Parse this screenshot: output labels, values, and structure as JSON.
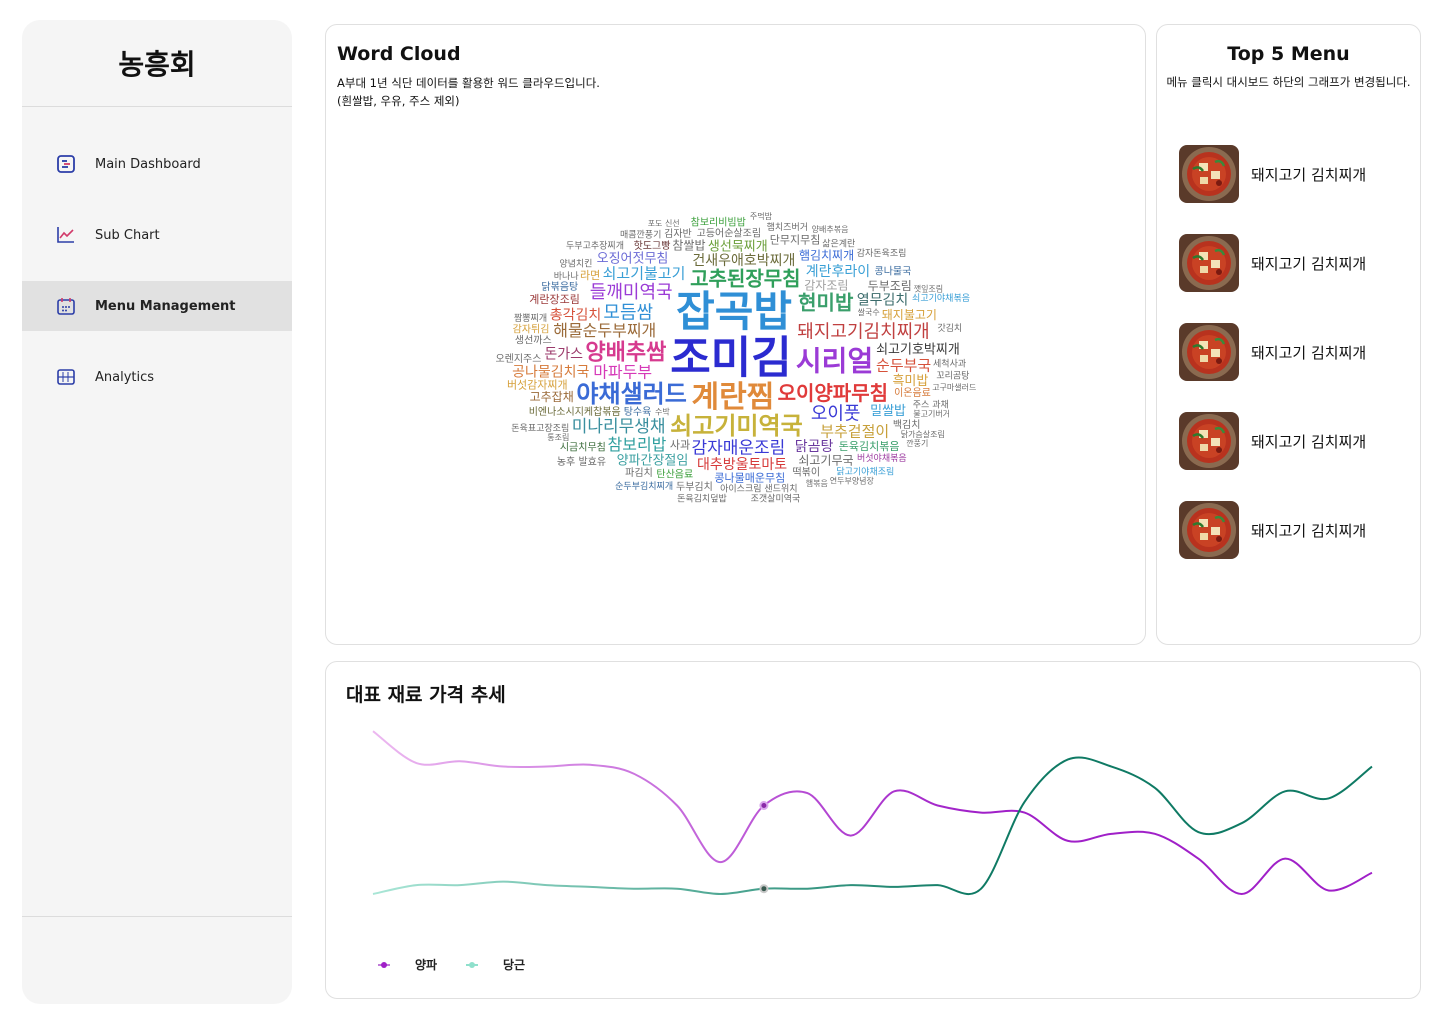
{
  "sidebar": {
    "brand": "농흥회",
    "items": [
      {
        "label": "Main Dashboard",
        "icon": "dashboard-icon",
        "active": false
      },
      {
        "label": "Sub Chart",
        "icon": "line-chart-icon",
        "active": false
      },
      {
        "label": "Menu Management",
        "icon": "calendar-icon",
        "active": true
      },
      {
        "label": "Analytics",
        "icon": "analytics-icon",
        "active": false
      }
    ]
  },
  "word_cloud": {
    "title": "Word Cloud",
    "description_line1": "A부대 1년 식단 데이터를 활용한 워드 클라우드입니다.",
    "description_line2": "(흰쌀밥, 우유, 주스 제외)",
    "words": [
      {
        "text": "조미김",
        "color": "#2b2bd0",
        "size": 44
      },
      {
        "text": "잡곡밥",
        "color": "#2f8fd6",
        "size": 42
      },
      {
        "text": "계란찜",
        "color": "#e08a3a",
        "size": 30
      },
      {
        "text": "시리얼",
        "color": "#9b3bd6",
        "size": 28
      },
      {
        "text": "쇠고기미역국",
        "color": "#c7b23a",
        "size": 24
      },
      {
        "text": "야채샐러드",
        "color": "#3a6bd6",
        "size": 24
      },
      {
        "text": "오이양파무침",
        "color": "#e03a3a",
        "size": 20
      },
      {
        "text": "양배추쌈",
        "color": "#d63a8f",
        "size": 22
      },
      {
        "text": "고추된장무침",
        "color": "#2f9f5a",
        "size": 20
      },
      {
        "text": "돼지고기김치찌개",
        "color": "#c04040",
        "size": 18
      },
      {
        "text": "해물순두부찌개",
        "color": "#9b6b3a",
        "size": 16
      },
      {
        "text": "모듬쌈",
        "color": "#2f8fd6",
        "size": 18
      },
      {
        "text": "현미밥",
        "color": "#3a9f6b",
        "size": 20
      },
      {
        "text": "들깨미역국",
        "color": "#9b3bd6",
        "size": 18
      },
      {
        "text": "감자매운조림",
        "color": "#3a3ad6",
        "size": 17
      },
      {
        "text": "오이풋",
        "color": "#3a3ad6",
        "size": 18
      },
      {
        "text": "미나리무생채",
        "color": "#3a8f9f",
        "size": 17
      },
      {
        "text": "마파두부",
        "color": "#d63ab8",
        "size": 16
      },
      {
        "text": "건새우애호박찌개",
        "color": "#6b6b3a",
        "size": 14
      },
      {
        "text": "쇠고기불고기",
        "color": "#3a9fd6",
        "size": 15
      },
      {
        "text": "참보리밥",
        "color": "#2f9f9f",
        "size": 16
      },
      {
        "text": "부추겉절이",
        "color": "#c7a03a",
        "size": 15
      },
      {
        "text": "대추방울토마토",
        "color": "#d63a3a",
        "size": 14
      },
      {
        "text": "순두부국",
        "color": "#d6513a",
        "size": 15
      },
      {
        "text": "계란후라이",
        "color": "#3aa0d6",
        "size": 14
      },
      {
        "text": "총각김치",
        "color": "#d6513a",
        "size": 14
      },
      {
        "text": "닭곰탕",
        "color": "#6b3a9f",
        "size": 14
      },
      {
        "text": "열무김치",
        "color": "#3a6b6b",
        "size": 14
      },
      {
        "text": "공나물김치국",
        "color": "#d67a3a",
        "size": 14
      },
      {
        "text": "생선묵찌개",
        "color": "#6b9f3a",
        "size": 13
      },
      {
        "text": "쇠고기호박찌개",
        "color": "#3a3a3a",
        "size": 13
      },
      {
        "text": "양파간장절임",
        "color": "#3a9fa0",
        "size": 13
      },
      {
        "text": "오징어젓무침",
        "color": "#6b6bd6",
        "size": 13
      },
      {
        "text": "돼지불고기",
        "color": "#d6a03a",
        "size": 12
      },
      {
        "text": "햄김치찌개",
        "color": "#3a6bd6",
        "size": 12
      },
      {
        "text": "돈가스",
        "color": "#9b3a6b",
        "size": 14
      },
      {
        "text": "밀쌀밥",
        "color": "#3a9fd6",
        "size": 13
      },
      {
        "text": "흑미밥",
        "color": "#d6a03a",
        "size": 13
      },
      {
        "text": "감자조림",
        "color": "#9f9f9f",
        "size": 12
      },
      {
        "text": "참쌀밥",
        "color": "#6b6b6b",
        "size": 12
      },
      {
        "text": "고추잡채",
        "color": "#9b6b3a",
        "size": 12
      },
      {
        "text": "쇠고기무국",
        "color": "#6b6b6b",
        "size": 12
      },
      {
        "text": "두부조림",
        "color": "#6b6b6b",
        "size": 12
      },
      {
        "text": "콩나물매운무침",
        "color": "#3a6bd6",
        "size": 11
      },
      {
        "text": "돈육김치볶음",
        "color": "#3a9f6b",
        "size": 11
      },
      {
        "text": "버섯감자찌개",
        "color": "#d6a03a",
        "size": 11
      },
      {
        "text": "계란장조림",
        "color": "#9b3a3a",
        "size": 11
      },
      {
        "text": "탕수육",
        "color": "#3a6b9f",
        "size": 10
      },
      {
        "text": "단무지무침",
        "color": "#6b6b6b",
        "size": 11
      },
      {
        "text": "비엔나소시지케찹볶음",
        "color": "#6b6b3a",
        "size": 10
      },
      {
        "text": "이온음료",
        "color": "#d67a3a",
        "size": 10
      },
      {
        "text": "핫도그빵",
        "color": "#6b3a3a",
        "size": 10
      },
      {
        "text": "고등어순살조림",
        "color": "#6b6b6b",
        "size": 10
      },
      {
        "text": "탄산음료",
        "color": "#3a9f3a",
        "size": 10
      },
      {
        "text": "생선까스",
        "color": "#6b6b6b",
        "size": 10
      },
      {
        "text": "사과",
        "color": "#6b6b6b",
        "size": 11
      },
      {
        "text": "라면",
        "color": "#d6a03a",
        "size": 11
      },
      {
        "text": "떡볶이",
        "color": "#6b6b6b",
        "size": 10
      },
      {
        "text": "감자튀김",
        "color": "#d6a03a",
        "size": 10
      },
      {
        "text": "백김치",
        "color": "#6b6b6b",
        "size": 10
      },
      {
        "text": "닭볶음탕",
        "color": "#3a6b9f",
        "size": 10
      },
      {
        "text": "시금치무침",
        "color": "#3a6b3a",
        "size": 10
      },
      {
        "text": "콩나물국",
        "color": "#3a6b9f",
        "size": 10
      },
      {
        "text": "김자반",
        "color": "#6b6b6b",
        "size": 10
      },
      {
        "text": "오렌지주스",
        "color": "#6b6b6b",
        "size": 10
      },
      {
        "text": "두부김치",
        "color": "#6b6b6b",
        "size": 10
      },
      {
        "text": "파김치",
        "color": "#6b6b6b",
        "size": 10
      },
      {
        "text": "짬뽕찌개",
        "color": "#6b6b6b",
        "size": 9
      },
      {
        "text": "삶은계란",
        "color": "#6b6b6b",
        "size": 9
      },
      {
        "text": "아이스크림 샌드위치",
        "color": "#6b6b6b",
        "size": 9
      },
      {
        "text": "주스 과채",
        "color": "#6b6b6b",
        "size": 9
      },
      {
        "text": "햄치즈버거",
        "color": "#6b6b6b",
        "size": 9
      },
      {
        "text": "참보리비빔밥",
        "color": "#3a9f3a",
        "size": 10
      },
      {
        "text": "버섯야채볶음",
        "color": "#9b3a9f",
        "size": 9
      },
      {
        "text": "돈육표고장조림",
        "color": "#6b6b6b",
        "size": 9
      },
      {
        "text": "바나나",
        "color": "#6b6b6b",
        "size": 9
      },
      {
        "text": "농후 발효유",
        "color": "#6b6b6b",
        "size": 10
      },
      {
        "text": "세척사과",
        "color": "#6b6b6b",
        "size": 9
      },
      {
        "text": "감자돈육조림",
        "color": "#6b6b6b",
        "size": 9
      },
      {
        "text": "매콤깐풍기",
        "color": "#6b6b6b",
        "size": 9
      },
      {
        "text": "순두부김치찌개",
        "color": "#3a6b9f",
        "size": 9
      },
      {
        "text": "두부고추장찌개",
        "color": "#6b6b6b",
        "size": 9
      },
      {
        "text": "닭고기야채조림",
        "color": "#3a9fd6",
        "size": 9
      },
      {
        "text": "쇠고기야채볶음",
        "color": "#3a9fd6",
        "size": 9
      },
      {
        "text": "돈육김치덮밥",
        "color": "#6b6b6b",
        "size": 9
      },
      {
        "text": "양념치킨",
        "color": "#6b6b6b",
        "size": 9
      },
      {
        "text": "조갯살미역국",
        "color": "#6b6b6b",
        "size": 9
      },
      {
        "text": "꼬리곰탕",
        "color": "#6b6b6b",
        "size": 9
      },
      {
        "text": "쌀국수",
        "color": "#6b6b6b",
        "size": 8
      },
      {
        "text": "불고기버거",
        "color": "#6b6b6b",
        "size": 8
      },
      {
        "text": "고구마샐러드",
        "color": "#6b6b6b",
        "size": 8
      },
      {
        "text": "갓김치",
        "color": "#6b6b6b",
        "size": 9
      },
      {
        "text": "깻잎조림",
        "color": "#6b6b6b",
        "size": 8
      },
      {
        "text": "수박",
        "color": "#6b6b6b",
        "size": 8
      },
      {
        "text": "포도 신선",
        "color": "#6b6b6b",
        "size": 8
      },
      {
        "text": "닭가슴살조림",
        "color": "#6b6b6b",
        "size": 8
      },
      {
        "text": "양배추볶음",
        "color": "#6b6b6b",
        "size": 8
      },
      {
        "text": "연두부양념장",
        "color": "#6b6b6b",
        "size": 8
      },
      {
        "text": "통조림",
        "color": "#6b6b6b",
        "size": 8
      },
      {
        "text": "햄볶음",
        "color": "#6b6b6b",
        "size": 8
      },
      {
        "text": "주먹밥",
        "color": "#6b6b6b",
        "size": 8
      },
      {
        "text": "깐풍기",
        "color": "#6b6b6b",
        "size": 8
      }
    ]
  },
  "top_menu": {
    "title": "Top 5 Menu",
    "description": "메뉴 클릭시 대시보드 하단의 그래프가 변경됩니다.",
    "items": [
      {
        "label": "돼지고기 김치찌개",
        "icon": "stew-image"
      },
      {
        "label": "돼지고기 김치찌개",
        "icon": "stew-image"
      },
      {
        "label": "돼지고기 김치찌개",
        "icon": "stew-image"
      },
      {
        "label": "돼지고기 김치찌개",
        "icon": "stew-image"
      },
      {
        "label": "돼지고기 김치찌개",
        "icon": "stew-image"
      }
    ]
  },
  "price_trend": {
    "title": "대표 재료 가격 추세"
  },
  "chart_data": {
    "type": "line",
    "title": "대표 재료 가격 추세",
    "xlabel": "",
    "ylabel": "",
    "grid": false,
    "legend_position": "bottom-left",
    "x": [
      0,
      1,
      2,
      3,
      4,
      5,
      6,
      7,
      8,
      9,
      10,
      11,
      12,
      13,
      14,
      15,
      16,
      17,
      18,
      19,
      20,
      21,
      22,
      23
    ],
    "ylim": [
      0,
      100
    ],
    "highlight_index": 9,
    "series": [
      {
        "name": "양파",
        "color": "#a020c8",
        "values": [
          92,
          74,
          75,
          72,
          72,
          73,
          68,
          50,
          18,
          50,
          57,
          33,
          58,
          50,
          46,
          46,
          30,
          34,
          34,
          20,
          0,
          20,
          2,
          12
        ]
      },
      {
        "name": "당근",
        "color": "#0f7a64",
        "values": [
          0,
          5,
          5,
          7,
          5,
          4,
          3,
          3,
          0,
          3,
          3,
          5,
          4,
          5,
          3,
          52,
          76,
          72,
          60,
          35,
          40,
          58,
          54,
          72
        ]
      }
    ]
  }
}
